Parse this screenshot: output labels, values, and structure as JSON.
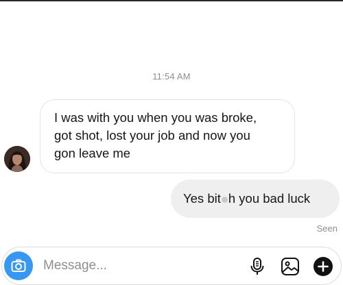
{
  "thread": {
    "timestamp": "11:54 AM",
    "messages": [
      {
        "direction": "incoming",
        "lines": [
          "I was with you when you was broke,",
          "got shot, lost your job and now you",
          "gon leave me"
        ]
      },
      {
        "direction": "outgoing",
        "before": "Yes bit",
        "after": "h you bad luck"
      }
    ],
    "seen_label": "Seen"
  },
  "composer": {
    "placeholder": "Message...",
    "icons": [
      "camera-icon",
      "microphone-icon",
      "image-icon",
      "plus-icon"
    ],
    "accent_color": "#3897f0"
  },
  "colors": {
    "incoming_bubble_border": "#e3e3e3",
    "outgoing_bubble_bg": "#efefef",
    "meta_text": "#8e8e8e"
  }
}
